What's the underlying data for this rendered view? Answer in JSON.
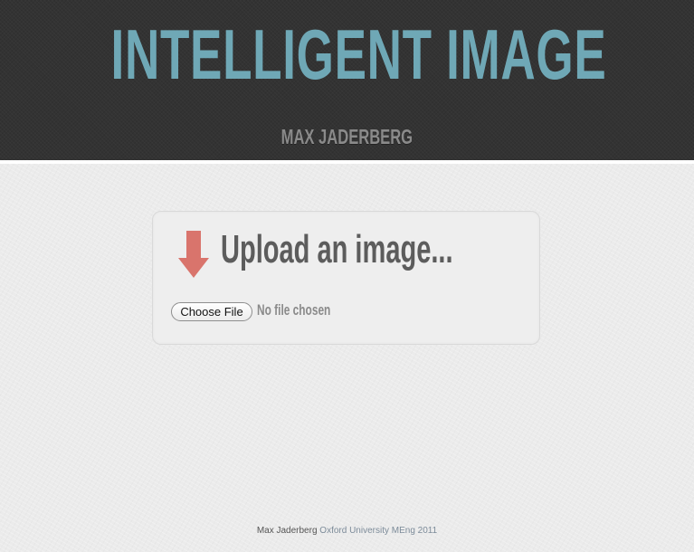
{
  "header": {
    "title": "INTELLIGENT IMAGE",
    "author": "MAX JADERBERG"
  },
  "upload": {
    "icon": "down-arrow-icon",
    "heading": "Upload an image...",
    "choose_file_label": "Choose File",
    "file_status": "No file chosen"
  },
  "footer": {
    "name": "Max Jaderberg",
    "rest": "Oxford University MEng 2011"
  },
  "colors": {
    "header_bg": "#333333",
    "title": "#6fa8b6",
    "arrow": "#d9746c",
    "page_bg": "#ebebeb"
  }
}
